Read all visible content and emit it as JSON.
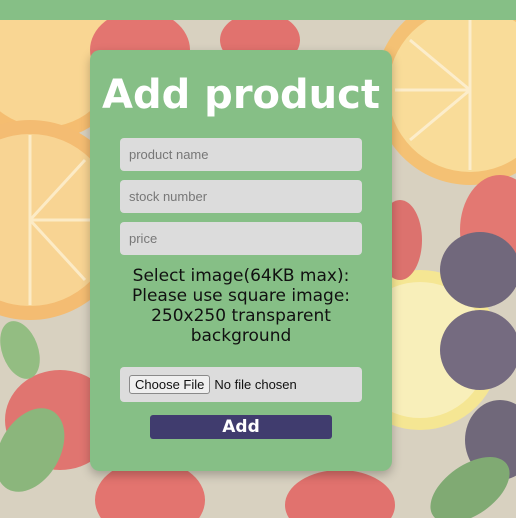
{
  "form": {
    "title": "Add product",
    "fields": [
      {
        "placeholder": "product name"
      },
      {
        "placeholder": "stock number"
      },
      {
        "placeholder": "price"
      }
    ],
    "instructions": [
      "Select image(64KB max):",
      "Please use square image:",
      "250x250 transparent",
      "background"
    ],
    "file_button_label": "Choose File",
    "file_status": "No file chosen",
    "submit_label": "Add"
  },
  "colors": {
    "topbar": "#86bf86",
    "card": "#86bf86",
    "submit_button": "#403c6e",
    "title_text": "#ffffff"
  }
}
